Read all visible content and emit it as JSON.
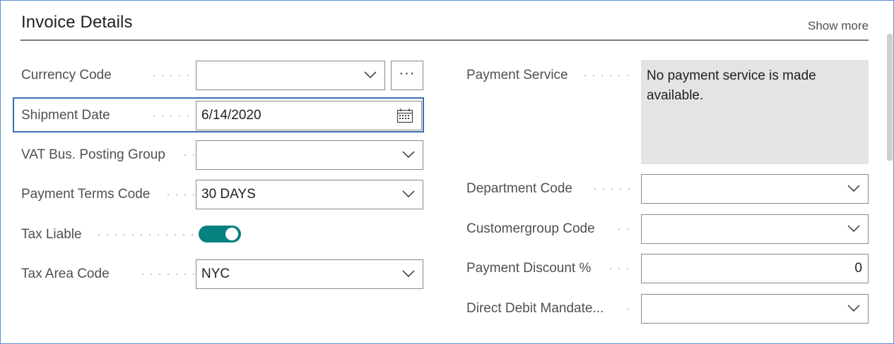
{
  "header": {
    "title": "Invoice Details",
    "show_more": "Show more"
  },
  "left": {
    "currency_code": {
      "label": "Currency Code",
      "value": ""
    },
    "shipment_date": {
      "label": "Shipment Date",
      "value": "6/14/2020"
    },
    "vat_bus_posting_group": {
      "label": "VAT Bus. Posting Group",
      "value": ""
    },
    "payment_terms_code": {
      "label": "Payment Terms Code",
      "value": "30 DAYS"
    },
    "tax_liable": {
      "label": "Tax Liable",
      "on": true
    },
    "tax_area_code": {
      "label": "Tax Area Code",
      "value": "NYC"
    }
  },
  "right": {
    "payment_service": {
      "label": "Payment Service",
      "value": "No payment service is made available."
    },
    "department_code": {
      "label": "Department Code",
      "value": ""
    },
    "customergroup_code": {
      "label": "Customergroup Code",
      "value": ""
    },
    "payment_discount": {
      "label": "Payment Discount %",
      "value": "0"
    },
    "direct_debit_mandate": {
      "label": "Direct Debit Mandate...",
      "value": ""
    }
  },
  "buttons": {
    "lookup_label": "···"
  },
  "icons": {
    "dropdown": "chevron-down-icon",
    "calendar": "calendar-icon"
  },
  "colors": {
    "toggle_on": "#078080",
    "focus_border": "#3a6fb4",
    "info_background": "#e4e4e4"
  }
}
